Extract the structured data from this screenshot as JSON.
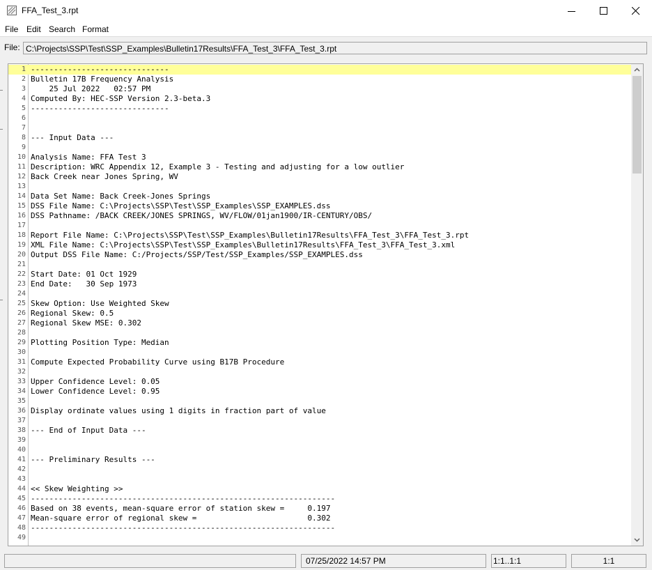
{
  "window": {
    "title": "FFA_Test_3.rpt"
  },
  "menu": [
    "File",
    "Edit",
    "Search",
    "Format"
  ],
  "file_row": {
    "label": "File:",
    "path": "C:\\Projects\\SSP\\Test\\SSP_Examples\\Bulletin17Results\\FFA_Test_3\\FFA_Test_3.rpt"
  },
  "editor": {
    "lines": [
      "------------------------------",
      "Bulletin 17B Frequency Analysis",
      "    25 Jul 2022   02:57 PM",
      "Computed By: HEC-SSP Version 2.3-beta.3",
      "------------------------------",
      "",
      "",
      "--- Input Data ---",
      "",
      "Analysis Name: FFA Test 3",
      "Description: WRC Appendix 12, Example 3 - Testing and adjusting for a low outlier",
      "Back Creek near Jones Spring, WV",
      "",
      "Data Set Name: Back Creek-Jones Springs",
      "DSS File Name: C:\\Projects\\SSP\\Test\\SSP_Examples\\SSP_EXAMPLES.dss",
      "DSS Pathname: /BACK CREEK/JONES SPRINGS, WV/FLOW/01jan1900/IR-CENTURY/OBS/",
      "",
      "Report File Name: C:\\Projects\\SSP\\Test\\SSP_Examples\\Bulletin17Results\\FFA_Test_3\\FFA_Test_3.rpt",
      "XML File Name: C:\\Projects\\SSP\\Test\\SSP_Examples\\Bulletin17Results\\FFA_Test_3\\FFA_Test_3.xml",
      "Output DSS File Name: C:/Projects/SSP/Test/SSP_Examples/SSP_EXAMPLES.dss",
      "",
      "Start Date: 01 Oct 1929",
      "End Date:   30 Sep 1973",
      "",
      "Skew Option: Use Weighted Skew",
      "Regional Skew: 0.5",
      "Regional Skew MSE: 0.302",
      "",
      "Plotting Position Type: Median",
      "",
      "Compute Expected Probability Curve using B17B Procedure",
      "",
      "Upper Confidence Level: 0.05",
      "Lower Confidence Level: 0.95",
      "",
      "Display ordinate values using 1 digits in fraction part of value",
      "",
      "--- End of Input Data ---",
      "",
      "",
      "--- Preliminary Results ---",
      "",
      "",
      "<< Skew Weighting >>",
      "------------------------------------------------------------------",
      "Based on 38 events, mean-square error of station skew =     0.197",
      "Mean-square error of regional skew =                        0.302",
      "------------------------------------------------------------------",
      ""
    ]
  },
  "status": {
    "field1": "",
    "datetime": "07/25/2022 14:57 PM",
    "selection": "1:1..1:1",
    "position": "1:1"
  }
}
